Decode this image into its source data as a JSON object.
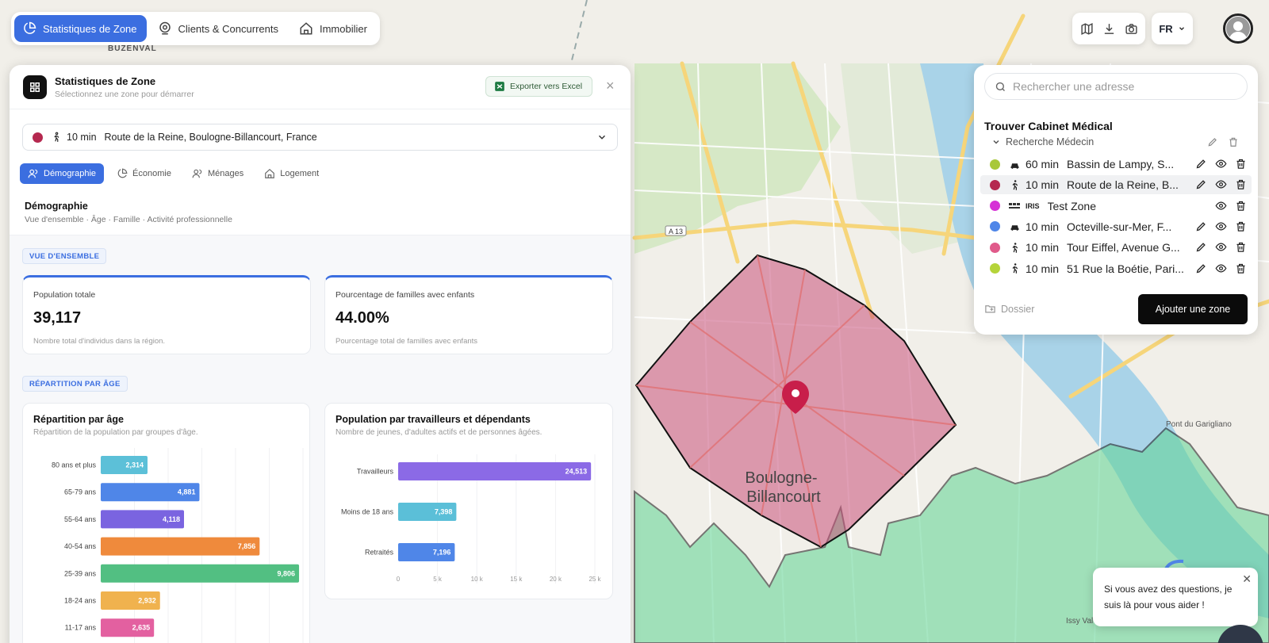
{
  "nav": {
    "tabs": [
      {
        "label": "Statistiques de Zone",
        "active": true
      },
      {
        "label": "Clients & Concurrents",
        "active": false
      },
      {
        "label": "Immobilier",
        "active": false
      }
    ],
    "language": "FR"
  },
  "map": {
    "labels": {
      "buzenval": "BUZENVAL",
      "city_line1": "Boulogne-",
      "city_line2": "Billancourt",
      "road_a13": "A 13",
      "pont": "Pont du Garigliano",
      "issy": "Issy Val"
    },
    "colors": {
      "zone_fill": "#c9507a",
      "green_zone": "#5fd493"
    }
  },
  "panel": {
    "title": "Statistiques de Zone",
    "subtitle": "Sélectionnez une zone pour démarrer",
    "export_label": "Exporter vers Excel",
    "selected_zone": {
      "color": "#b5284f",
      "time": "10 min",
      "address": "Route de la Reine, Boulogne-Billancourt, France"
    },
    "tabs": [
      {
        "label": "Démographie",
        "active": true
      },
      {
        "label": "Économie",
        "active": false
      },
      {
        "label": "Ménages",
        "active": false
      },
      {
        "label": "Logement",
        "active": false
      }
    ],
    "section": {
      "title": "Démographie",
      "subtitle": "Vue d'ensemble · Âge · Famille · Activité professionnelle"
    },
    "overview_chip": "VUE D'ENSEMBLE",
    "stats": [
      {
        "label": "Population totale",
        "value": "39,117",
        "desc": "Nombre total d'individus dans la région."
      },
      {
        "label": "Pourcentage de familles avec enfants",
        "value": "44.00%",
        "desc": "Pourcentage total de familles avec enfants"
      }
    ],
    "age_chip": "RÉPARTITION PAR ÂGE",
    "age_chart_title": "Répartition par âge",
    "age_chart_subtitle": "Répartition de la population par groupes d'âge.",
    "workers_chart_title": "Population par travailleurs et dépendants",
    "workers_chart_subtitle": "Nombre de jeunes, d'adultes actifs et de personnes âgées."
  },
  "chart_data": [
    {
      "type": "bar",
      "orientation": "horizontal",
      "title": "Répartition par âge",
      "categories": [
        "80 ans et plus",
        "65-79 ans",
        "55-64 ans",
        "40-54 ans",
        "25-39 ans",
        "18-24 ans",
        "11-17 ans"
      ],
      "values": [
        2314,
        4881,
        4118,
        7856,
        9806,
        2932,
        2635
      ],
      "value_labels": [
        "2,314",
        "4,881",
        "4,118",
        "7,856",
        "9,806",
        "2,932",
        "2,635"
      ],
      "colors": [
        "#5cc0d8",
        "#4f86e8",
        "#7a64e0",
        "#ef8a3c",
        "#52bf82",
        "#f0b24e",
        "#e360a0"
      ],
      "xlim": [
        0,
        10000
      ]
    },
    {
      "type": "bar",
      "orientation": "horizontal",
      "title": "Population par travailleurs et dépendants",
      "categories": [
        "Travailleurs",
        "Moins de 18 ans",
        "Retraités"
      ],
      "values": [
        24513,
        7398,
        7196
      ],
      "value_labels": [
        "24,513",
        "7,398",
        "7,196"
      ],
      "colors": [
        "#8b6ae6",
        "#5bbfd8",
        "#4f86e8"
      ],
      "xlim": [
        0,
        25000
      ],
      "xticks": [
        "0",
        "5 k",
        "10 k",
        "15 k",
        "20 k",
        "25 k"
      ]
    }
  ],
  "right_panel": {
    "search_placeholder": "Rechercher une adresse",
    "group_title": "Trouver Cabinet Médical",
    "subgroup": "Recherche Médecin",
    "zones": [
      {
        "color": "#a8c83a",
        "mode": "car-icon",
        "time": "60 min",
        "address": "Bassin de Lampy, S...",
        "selected": false
      },
      {
        "color": "#b5284f",
        "mode": "walk-icon",
        "time": "10 min",
        "address": "Route de la Reine, B...",
        "selected": true
      },
      {
        "color": "#d631d6",
        "mode": "iris",
        "time": "IRIS",
        "address": "Test Zone",
        "selected": false
      },
      {
        "color": "#4f86e8",
        "mode": "car-icon",
        "time": "10 min",
        "address": "Octeville-sur-Mer, F...",
        "selected": false
      },
      {
        "color": "#e05a8a",
        "mode": "walk-icon",
        "time": "10 min",
        "address": "Tour Eiffel, Avenue G...",
        "selected": false
      },
      {
        "color": "#b5d43a",
        "mode": "walk-icon",
        "time": "10 min",
        "address": "51 Rue la Boétie, Pari...",
        "selected": false
      }
    ],
    "dossier_label": "Dossier",
    "add_zone_label": "Ajouter une zone"
  },
  "chat": {
    "message": "Si vous avez des questions, je suis là pour vous aider !"
  }
}
